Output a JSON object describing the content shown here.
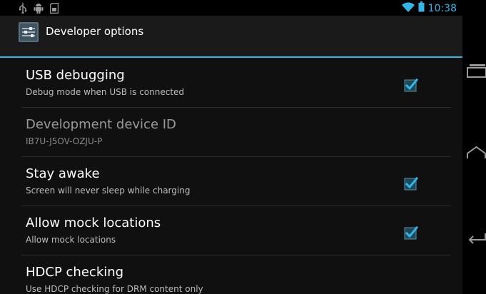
{
  "status_bar": {
    "time": "10:38",
    "left_icons": [
      "usb-icon",
      "android-debug-icon",
      "sd-card-icon"
    ],
    "right_icons": [
      "wifi-icon",
      "battery-icon"
    ]
  },
  "action_bar": {
    "icon": "developer-options-settings-icon",
    "title": "Developer options"
  },
  "preferences": [
    {
      "title": "USB debugging",
      "summary": "Debug mode when USB is connected",
      "checkbox": true,
      "checked": true,
      "enabled": true
    },
    {
      "title": "Development device ID",
      "summary": "IB7U-J5OV-OZJU-P",
      "checkbox": false,
      "checked": false,
      "enabled": false
    },
    {
      "title": "Stay awake",
      "summary": "Screen will never sleep while charging",
      "checkbox": true,
      "checked": true,
      "enabled": true
    },
    {
      "title": "Allow mock locations",
      "summary": "Allow mock locations",
      "checkbox": true,
      "checked": true,
      "enabled": true
    },
    {
      "title": "HDCP checking",
      "summary": "Use HDCP checking for DRM content only",
      "checkbox": false,
      "checked": false,
      "enabled": true
    }
  ],
  "nav_buttons": [
    "recent-apps-icon",
    "home-icon",
    "back-icon"
  ],
  "colors": {
    "accent": "#33b5e5",
    "background": "#101010",
    "action_bar": "#1a1a1a",
    "checkbox_fill": "#33b5e5"
  }
}
